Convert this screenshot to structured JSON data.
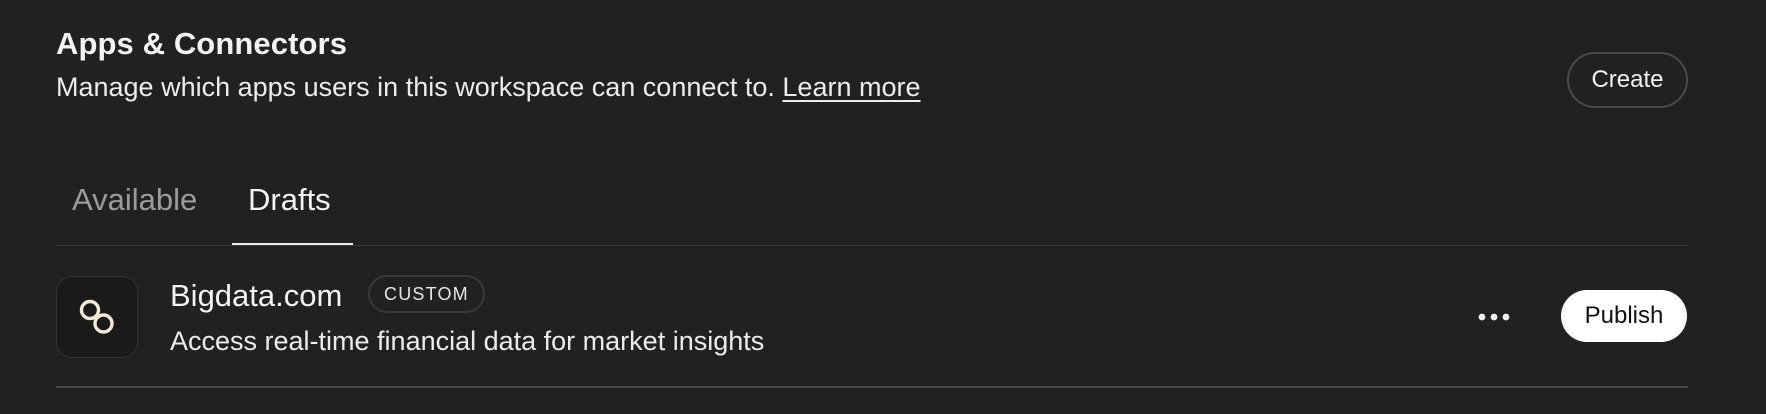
{
  "header": {
    "title": "Apps & Connectors",
    "subtitle": "Manage which apps users in this workspace can connect to.",
    "learn_more": "Learn more",
    "create_label": "Create"
  },
  "tabs": [
    {
      "label": "Available",
      "active": false
    },
    {
      "label": "Drafts",
      "active": true
    }
  ],
  "apps": [
    {
      "name": "Bigdata.com",
      "badge": "CUSTOM",
      "description": "Access real-time financial data for market insights",
      "icon": "bigdata-logo-icon",
      "more_icon": "more-horizontal-icon",
      "action_label": "Publish"
    }
  ]
}
